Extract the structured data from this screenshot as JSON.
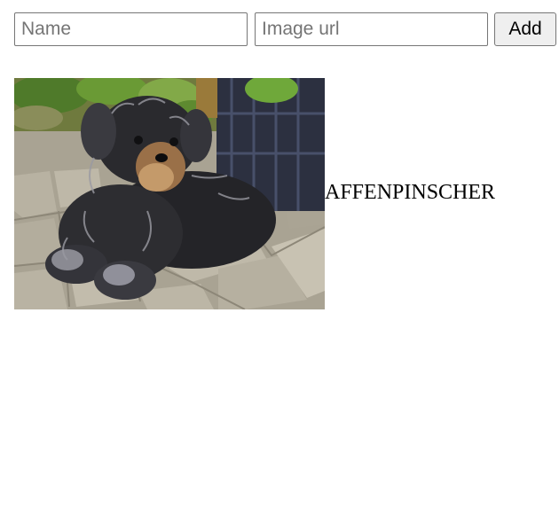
{
  "form": {
    "name_placeholder": "Name",
    "name_value": "",
    "url_placeholder": "Image url",
    "url_value": "",
    "add_label": "Add"
  },
  "dogs": [
    {
      "name": "AFFENPINSCHER",
      "image": "affenpinscher-dog-photo"
    }
  ],
  "colors": {
    "input_border": "#767676",
    "button_bg": "#efefef",
    "placeholder": "#757575"
  }
}
